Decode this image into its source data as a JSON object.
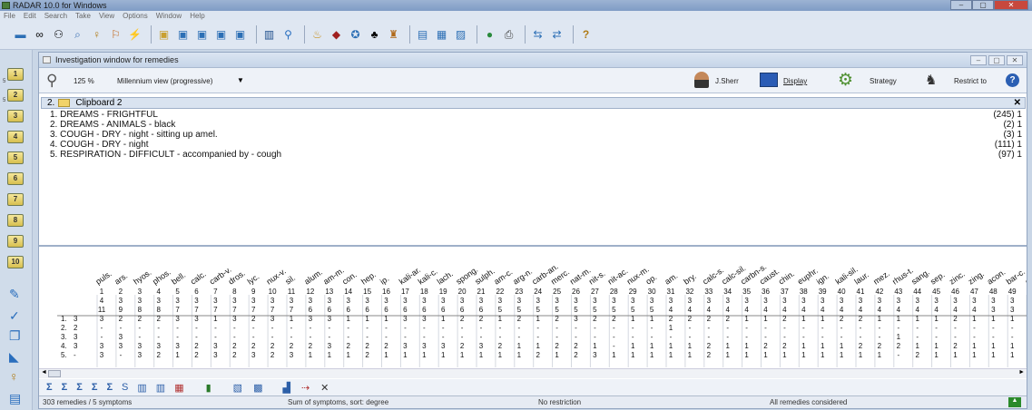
{
  "app": {
    "title": "RADAR 10.0 for Windows"
  },
  "menu": [
    "File",
    "Edit",
    "Search",
    "Take",
    "View",
    "Options",
    "Window",
    "Help"
  ],
  "investigation": {
    "title": "Investigation window for remedies",
    "zoom": "125 %",
    "view_mode": "Millennium view (progressive)",
    "user": "J.Sherr",
    "display_label": "Display",
    "strategy_label": "Strategy",
    "restrict_label": "Restrict to"
  },
  "clipboard": {
    "label": "2.",
    "name": "Clipboard 2",
    "rubrics": [
      {
        "text": "1. DREAMS - FRIGHTFUL",
        "count": "(245) 1"
      },
      {
        "text": "2. DREAMS - ANIMALS - black",
        "count": "(2) 1"
      },
      {
        "text": "3. COUGH - DRY - night - sitting up amel.",
        "count": "(3) 1"
      },
      {
        "text": "4. COUGH - DRY - night",
        "count": "(111) 1"
      },
      {
        "text": "5. RESPIRATION - DIFFICULT - accompanied by - cough",
        "count": "(97) 1"
      }
    ]
  },
  "remedies": [
    "puls.",
    "ars.",
    "hyos.",
    "phos.",
    "bell.",
    "calc.",
    "carb-v.",
    "dros.",
    "lyc.",
    "nux-v.",
    "sil.",
    "alum.",
    "am-m.",
    "con.",
    "hep.",
    "ip.",
    "kali-ar.",
    "kali-c.",
    "lach.",
    "spong.",
    "sulph.",
    "am-c.",
    "arg-n.",
    "carb-an.",
    "merc.",
    "nat-m.",
    "nit-s.",
    "nit-ac.",
    "nux-m.",
    "op.",
    "am.",
    "bry.",
    "calc-s.",
    "calc-sil.",
    "carbn-s.",
    "caust.",
    "chin.",
    "euphr.",
    "ign.",
    "kali-sil.",
    "laur.",
    "mez.",
    "rhus-t.",
    "sang.",
    "sep.",
    "zinc.",
    "zing.",
    "acon.",
    "bar-c.",
    "chin"
  ],
  "totals_row1": [
    "4",
    "3",
    "3",
    "3",
    "3",
    "3",
    "3",
    "3",
    "3",
    "3",
    "3",
    "3",
    "3",
    "3",
    "3",
    "3",
    "3",
    "3",
    "3",
    "3",
    "3",
    "3",
    "3",
    "3",
    "3",
    "3",
    "3",
    "3",
    "3",
    "3",
    "3",
    "3",
    "3",
    "3",
    "3",
    "3",
    "3",
    "3",
    "3",
    "3",
    "3",
    "3",
    "3",
    "3",
    "3",
    "3",
    "3",
    "3",
    "3",
    "3"
  ],
  "totals_row2": [
    "11",
    "9",
    "8",
    "8",
    "7",
    "7",
    "7",
    "7",
    "7",
    "7",
    "7",
    "6",
    "6",
    "6",
    "6",
    "6",
    "6",
    "6",
    "6",
    "6",
    "6",
    "5",
    "5",
    "5",
    "5",
    "5",
    "5",
    "5",
    "5",
    "5",
    "4",
    "4",
    "4",
    "4",
    "4",
    "4",
    "4",
    "4",
    "4",
    "4",
    "4",
    "4",
    "4",
    "4",
    "4",
    "4",
    "4",
    "3",
    "3",
    "3"
  ],
  "rows": [
    {
      "num": "1.",
      "w": "3",
      "vals": [
        "3",
        "2",
        "2",
        "2",
        "3",
        "3",
        "1",
        "3",
        "2",
        "3",
        "1",
        "3",
        "3",
        "1",
        "1",
        "1",
        "3",
        "3",
        "1",
        "2",
        "2",
        "1",
        "2",
        "1",
        "2",
        "3",
        "2",
        "2",
        "1",
        "1",
        "2",
        "2",
        "2",
        "2",
        "1",
        "1",
        "2",
        "1",
        "1",
        "2",
        "2",
        "1",
        "1",
        "1",
        "1",
        "2",
        "1",
        "1",
        "1",
        "1"
      ]
    },
    {
      "num": "2.",
      "w": "2",
      "vals": [
        "-",
        "-",
        "-",
        "-",
        "-",
        "-",
        "-",
        "-",
        "-",
        "-",
        "-",
        "-",
        "-",
        "-",
        "-",
        "-",
        "-",
        "-",
        "-",
        "-",
        "-",
        "-",
        "-",
        "-",
        "-",
        "-",
        "-",
        "-",
        "-",
        "-",
        "1",
        "-",
        "-",
        "-",
        "-",
        "-",
        "-",
        "-",
        "-",
        "-",
        "-",
        "-",
        "-",
        "-",
        "-",
        "-",
        "-",
        "-",
        "-",
        "-"
      ]
    },
    {
      "num": "3.",
      "w": "3",
      "vals": [
        "-",
        "3",
        "-",
        "-",
        "-",
        "-",
        "-",
        "-",
        "-",
        "-",
        "-",
        "-",
        "-",
        "-",
        "-",
        "-",
        "-",
        "-",
        "-",
        "-",
        "-",
        "-",
        "-",
        "-",
        "-",
        "-",
        "-",
        "-",
        "-",
        "-",
        "-",
        "-",
        "-",
        "-",
        "-",
        "-",
        "-",
        "-",
        "-",
        "-",
        "-",
        "-",
        "1",
        "-",
        "-",
        "-",
        "-",
        "-",
        "-",
        "-"
      ]
    },
    {
      "num": "4.",
      "w": "3",
      "vals": [
        "3",
        "3",
        "3",
        "3",
        "3",
        "2",
        "3",
        "2",
        "2",
        "2",
        "2",
        "2",
        "3",
        "2",
        "2",
        "2",
        "3",
        "3",
        "3",
        "2",
        "3",
        "2",
        "1",
        "1",
        "2",
        "2",
        "1",
        "-",
        "1",
        "1",
        "1",
        "1",
        "2",
        "1",
        "1",
        "2",
        "2",
        "1",
        "1",
        "1",
        "2",
        "2",
        "2",
        "1",
        "1",
        "2",
        "1",
        "1",
        "1",
        "1"
      ]
    },
    {
      "num": "5.",
      "w": "-",
      "vals": [
        "3",
        "-",
        "3",
        "2",
        "1",
        "2",
        "3",
        "2",
        "3",
        "2",
        "3",
        "1",
        "1",
        "1",
        "2",
        "1",
        "1",
        "1",
        "1",
        "1",
        "1",
        "1",
        "1",
        "2",
        "1",
        "2",
        "3",
        "1",
        "1",
        "1",
        "1",
        "1",
        "2",
        "1",
        "1",
        "1",
        "1",
        "1",
        "1",
        "1",
        "1",
        "1",
        "-",
        "2",
        "1",
        "1",
        "1",
        "1",
        "1",
        "1"
      ]
    }
  ],
  "status": {
    "remedies": "303 remedies / 5 symptoms",
    "sort": "Sum of symptoms, sort: degree",
    "restriction": "No restriction",
    "considered": "All remedies considered"
  },
  "left_tabs": [
    "1",
    "2",
    "3",
    "4",
    "5",
    "6",
    "7",
    "8",
    "9",
    "10"
  ],
  "left_tab_sides": [
    "5",
    "5"
  ],
  "colors": {
    "title_bar": "#8aa6cc",
    "window_bg": "#ffffff",
    "accent": "#2f5fa8"
  }
}
